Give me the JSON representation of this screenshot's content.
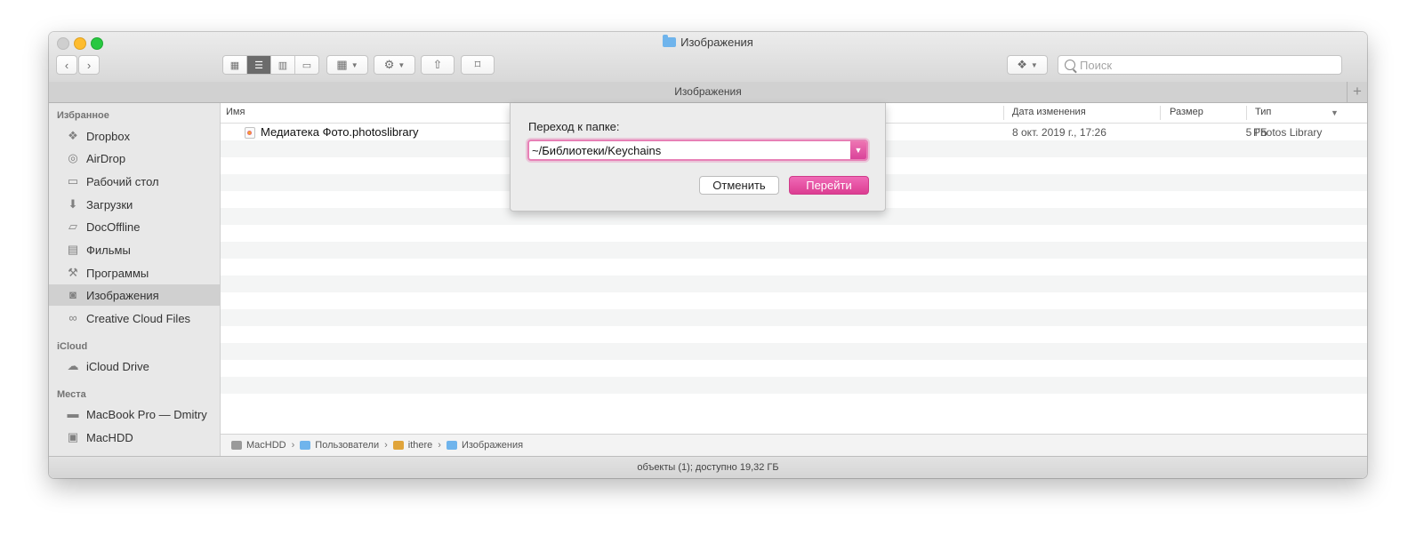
{
  "window": {
    "title": "Изображения",
    "path_title": "Изображения"
  },
  "toolbar": {
    "back_icon": "chevron-left-icon",
    "forward_icon": "chevron-right-icon",
    "search_placeholder": "Поиск",
    "search_value": ""
  },
  "sidebar": {
    "favorites_heading": "Избранное",
    "favorites": [
      {
        "label": "Dropbox",
        "icon": "dropbox-icon"
      },
      {
        "label": "AirDrop",
        "icon": "airdrop-icon"
      },
      {
        "label": "Рабочий стол",
        "icon": "desktop-icon"
      },
      {
        "label": "Загрузки",
        "icon": "downloads-icon"
      },
      {
        "label": "DocOffline",
        "icon": "folder-icon"
      },
      {
        "label": "Фильмы",
        "icon": "film-icon"
      },
      {
        "label": "Программы",
        "icon": "applications-icon"
      },
      {
        "label": "Изображения",
        "icon": "camera-icon",
        "selected": true
      },
      {
        "label": "Creative Cloud Files",
        "icon": "creative-cloud-icon"
      }
    ],
    "icloud_heading": "iCloud",
    "icloud": [
      {
        "label": "iCloud Drive",
        "icon": "cloud-icon"
      }
    ],
    "places_heading": "Места",
    "places": [
      {
        "label": "MacBook Pro — Dmitry",
        "icon": "laptop-icon"
      },
      {
        "label": "MacHDD",
        "icon": "disk-icon"
      }
    ]
  },
  "columns": {
    "name": "Имя",
    "date": "Дата изменения",
    "size": "Размер",
    "kind": "Тип"
  },
  "files": [
    {
      "name": "Медиатека Фото.photoslibrary",
      "date": "8 окт. 2019 г., 17:26",
      "size": "5 ГБ",
      "kind": "Photos Library"
    }
  ],
  "breadcrumbs": [
    "MacHDD",
    "Пользователи",
    "ithere",
    "Изображения"
  ],
  "status": "объекты (1); доступно 19,32 ГБ",
  "dialog": {
    "label": "Переход к папке:",
    "value": "~/Библиотеки/Keychains",
    "cancel": "Отменить",
    "go": "Перейти"
  },
  "colors": {
    "accent": "#e0479b",
    "focus_ring": "#e780b6"
  }
}
